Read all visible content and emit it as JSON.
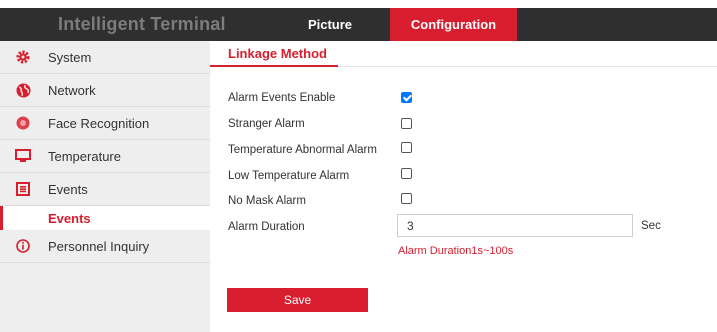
{
  "header": {
    "brand": "Intelligent Terminal",
    "tabs": [
      {
        "label": "Picture",
        "active": false
      },
      {
        "label": "Configuration",
        "active": true
      }
    ]
  },
  "sidebar": {
    "items": [
      {
        "label": "System",
        "icon": "gear-icon"
      },
      {
        "label": "Network",
        "icon": "globe-icon"
      },
      {
        "label": "Face Recognition",
        "icon": "face-icon"
      },
      {
        "label": "Temperature",
        "icon": "monitor-icon"
      },
      {
        "label": "Events",
        "icon": "events-icon"
      },
      {
        "label": "Personnel Inquiry",
        "icon": "info-icon"
      }
    ],
    "sub_item": {
      "label": "Events",
      "active": true
    }
  },
  "main": {
    "section_title": "Linkage Method",
    "options": [
      {
        "label": "Alarm Events Enable",
        "checked": true
      },
      {
        "label": "Stranger Alarm",
        "checked": false
      },
      {
        "label": "Temperature Abnormal Alarm",
        "checked": false
      },
      {
        "label": "Low Temperature Alarm",
        "checked": false
      },
      {
        "label": "No Mask Alarm",
        "checked": false
      }
    ],
    "duration": {
      "label": "Alarm Duration",
      "value": "3",
      "unit": "Sec",
      "hint": "Alarm Duration1s~100s"
    },
    "save_label": "Save"
  },
  "colors": {
    "accent": "#d81e2e",
    "header_bg": "#2f2f2f",
    "sidebar_bg": "#eeeeee",
    "checkbox_checked": "#0075ff"
  }
}
